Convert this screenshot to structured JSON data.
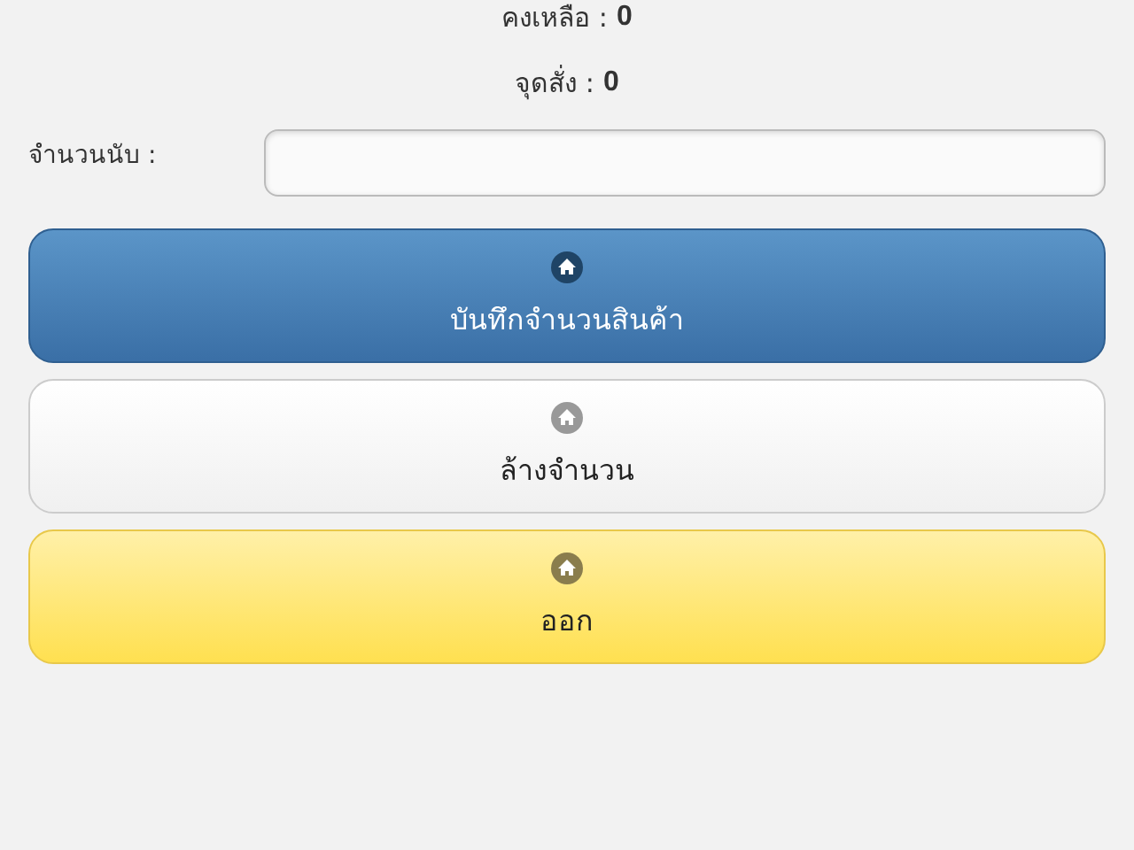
{
  "stats": [
    {
      "label": "คงเหลือ :",
      "value": "0"
    },
    {
      "label": "จุดสั่ง :",
      "value": "0"
    }
  ],
  "count_field": {
    "label": "จำนวนนับ :"
  },
  "buttons": [
    {
      "label": "บันทึกจำนวนสินค้า",
      "kind": "primary"
    },
    {
      "label": "ล้างจำนวน",
      "kind": "plain"
    },
    {
      "label": "ออก",
      "kind": "warning"
    }
  ]
}
